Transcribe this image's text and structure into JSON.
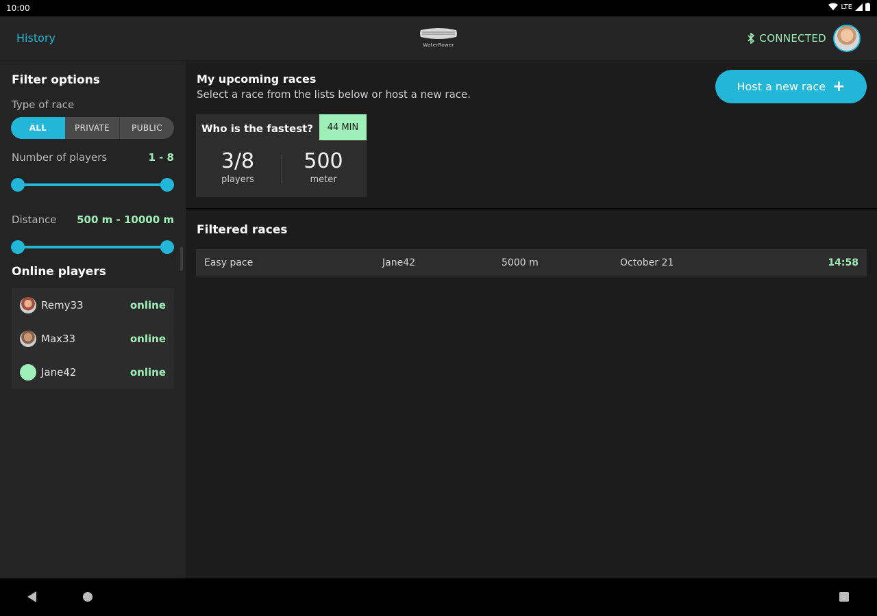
{
  "status_bar": {
    "time": "10:00",
    "network": "LTE"
  },
  "app_bar": {
    "history_label": "History",
    "logo_text": "WaterRower",
    "connection_label": "CONNECTED"
  },
  "sidebar": {
    "filter_title": "Filter options",
    "type_label": "Type of race",
    "type_options": [
      {
        "label": "ALL",
        "active": true
      },
      {
        "label": "PRIVATE",
        "active": false
      },
      {
        "label": "PUBLIC",
        "active": false
      }
    ],
    "players_label": "Number of players",
    "players_value": "1 - 8",
    "distance_label": "Distance",
    "distance_value": "500 m - 10000 m",
    "online_title": "Online players",
    "online_players": [
      {
        "name": "Remy33",
        "status": "online"
      },
      {
        "name": "Max33",
        "status": "online"
      },
      {
        "name": "Jane42",
        "status": "online"
      }
    ]
  },
  "upcoming": {
    "title": "My upcoming races",
    "subtitle": "Select a race from the lists below or host a new race.",
    "host_button_label": "Host a new race",
    "card": {
      "title": "Who is the fastest?",
      "badge": "44 MIN",
      "players_value": "3/8",
      "players_unit": "players",
      "distance_value": "500",
      "distance_unit": "meter"
    }
  },
  "filtered": {
    "title": "Filtered races",
    "rows": [
      {
        "name": "Easy pace",
        "host": "Jane42",
        "distance": "5000 m",
        "date": "October 21",
        "time": "14:58"
      }
    ]
  },
  "colors": {
    "accent": "#22b7d8",
    "success": "#9ff0b8",
    "surface": "#242424",
    "background": "#1c1c1c"
  }
}
